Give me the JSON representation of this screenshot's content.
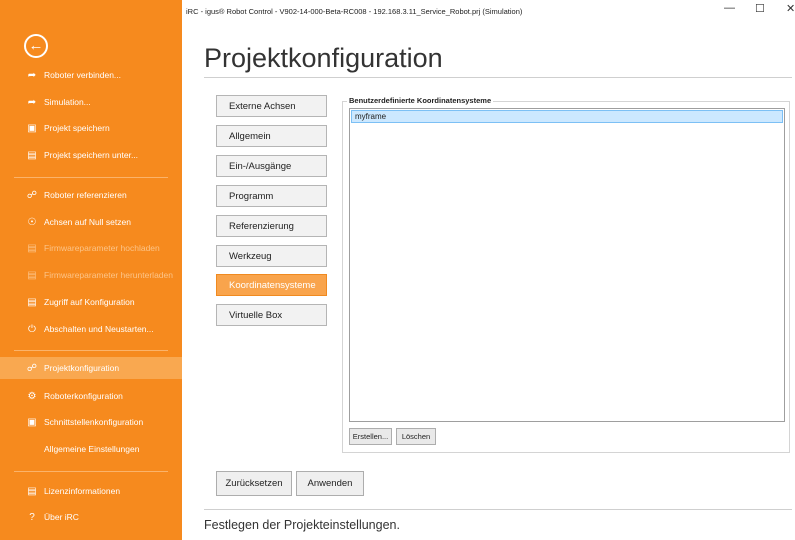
{
  "window": {
    "title": "iRC - igus® Robot Control - V902-14-000-Beta-RC008 - 192.168.3.11_Service_Robot.prj (Simulation)",
    "minimize_glyph": "—",
    "maximize_glyph": "☐",
    "close_glyph": "✕"
  },
  "sidebar": {
    "back_icon": "back-arrow-icon",
    "items": [
      {
        "label": "Roboter verbinden...",
        "icon": "connect-icon"
      },
      {
        "label": "Simulation...",
        "icon": "connect-icon"
      },
      {
        "label": "Projekt speichern",
        "icon": "save-icon"
      },
      {
        "label": "Projekt speichern unter...",
        "icon": "save-as-icon"
      },
      {
        "label": "Roboter referenzieren",
        "icon": "reference-icon"
      },
      {
        "label": "Achsen auf Null setzen",
        "icon": "zero-axes-icon"
      },
      {
        "label": "Firmwareparameter hochladen",
        "icon": "upload-icon"
      },
      {
        "label": "Firmwareparameter herunterladen",
        "icon": "download-icon"
      },
      {
        "label": "Zugriff auf Konfiguration",
        "icon": "config-access-icon"
      },
      {
        "label": "Abschalten und Neustarten...",
        "icon": "power-icon"
      },
      {
        "label": "Projektkonfiguration",
        "icon": "project-config-icon"
      },
      {
        "label": "Roboterkonfiguration",
        "icon": "gear-icon"
      },
      {
        "label": "Schnittstellenkonfiguration",
        "icon": "interface-icon"
      },
      {
        "label": "Allgemeine Einstellungen",
        "icon": ""
      },
      {
        "label": "Lizenzinformationen",
        "icon": "license-icon"
      },
      {
        "label": "Über iRC",
        "icon": "help-icon"
      }
    ]
  },
  "main": {
    "title": "Projektkonfiguration",
    "sections": [
      "Externe Achsen",
      "Allgemein",
      "Ein-/Ausgänge",
      "Programm",
      "Referenzierung",
      "Werkzeug",
      "Koordinatensysteme",
      "Virtuelle Box"
    ],
    "active_section": "Koordinatensysteme",
    "group_title": "Benutzerdefinierte Koordinatensysteme",
    "frames": [
      "myframe"
    ],
    "create_button": "Erstellen...",
    "delete_button": "Löschen",
    "reset_button": "Zurücksetzen",
    "apply_button": "Anwenden",
    "status_text": "Festlegen der Projekteinstellungen."
  },
  "colors": {
    "accent": "#f68a1e",
    "active_item": "#f9a850",
    "selection": "#cce8ff"
  }
}
